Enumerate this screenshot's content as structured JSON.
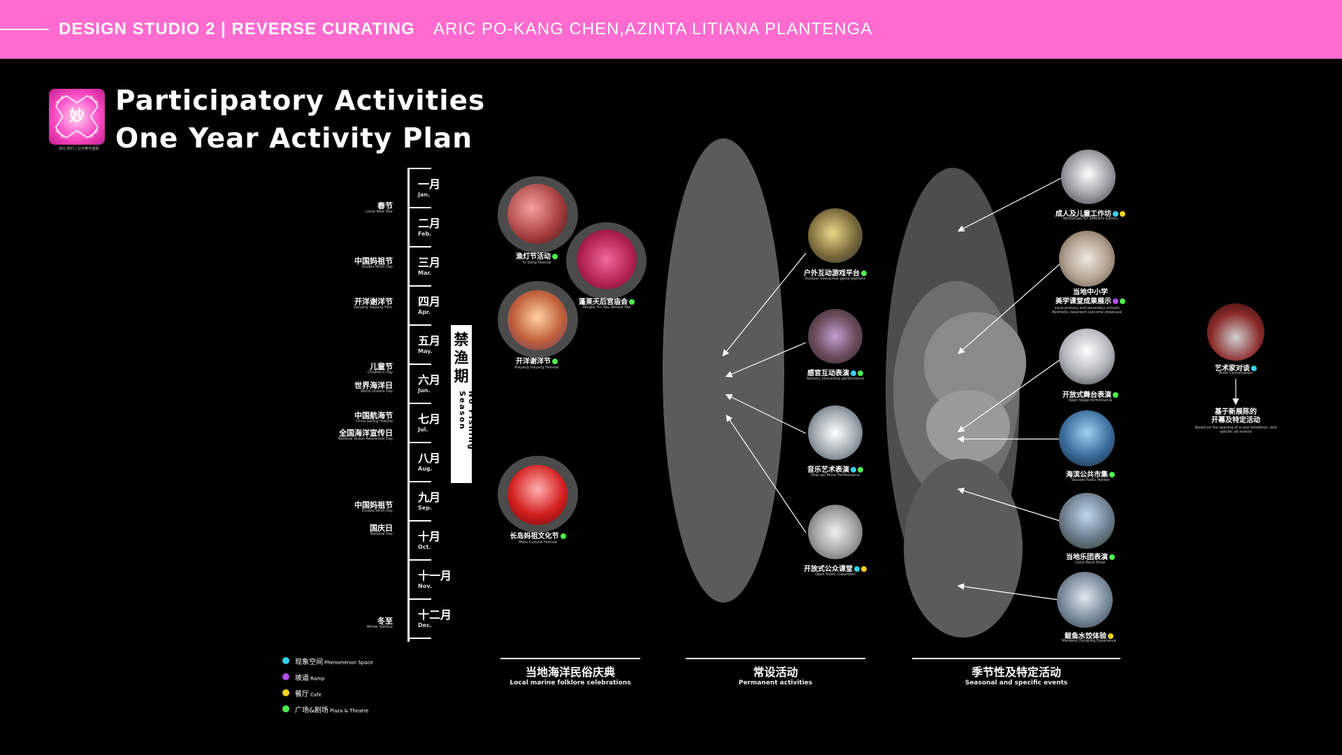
{
  "header": {
    "studio": "DESIGN STUDIO 2 | REVERSE CURATING",
    "authors": "ARIC PO-KANG CHEN,AZINTA LITIANA PLANTENGA"
  },
  "logo": {
    "glyph": "妙",
    "caption": "妙心·妙行 | 公众参与活动"
  },
  "title": {
    "line1": "Participatory Activities",
    "line2": "One Year Activity Plan"
  },
  "months": [
    {
      "zh": "一月",
      "en": "Jan."
    },
    {
      "zh": "二月",
      "en": "Feb."
    },
    {
      "zh": "三月",
      "en": "Mar."
    },
    {
      "zh": "四月",
      "en": "Apr."
    },
    {
      "zh": "五月",
      "en": "May."
    },
    {
      "zh": "六月",
      "en": "Jun."
    },
    {
      "zh": "七月",
      "en": "Jul."
    },
    {
      "zh": "八月",
      "en": "Aug."
    },
    {
      "zh": "九月",
      "en": "Sep."
    },
    {
      "zh": "十月",
      "en": "Oct."
    },
    {
      "zh": "十一月",
      "en": "Nov."
    },
    {
      "zh": "十二月",
      "en": "Dec."
    }
  ],
  "festivals": [
    {
      "zh": "春节",
      "en": "Lunar New Year"
    },
    {
      "zh": "中国妈祖节",
      "en": "Double Ninth Day"
    },
    {
      "zh": "开洋谢洋节",
      "en": "Kaiyang Xieyang Fest."
    },
    {
      "zh": "儿童节",
      "en": "Children's Day"
    },
    {
      "zh": "世界海洋日",
      "en": "World Oceans Day"
    },
    {
      "zh": "中国航海节",
      "en": "China Sailing Festival"
    },
    {
      "zh": "全国海洋宣传日",
      "en": "National Ocean Awareness Day"
    },
    {
      "zh": "中国妈祖节",
      "en": "Double Ninth Day"
    },
    {
      "zh": "国庆日",
      "en": "National Day"
    },
    {
      "zh": "冬至",
      "en": "Winter Solstice"
    }
  ],
  "no_fishing": {
    "zh": "禁渔期",
    "en": "No Fishing Season"
  },
  "folklore": [
    {
      "zh": "渔灯节活动",
      "en": "Yu Deng Festival",
      "dots": [
        "green"
      ]
    },
    {
      "zh": "蓬莱天后宫庙会",
      "en": "Penglai Tin Hau Temple Fair",
      "dots": [
        "green"
      ]
    },
    {
      "zh": "开洋谢洋节",
      "en": "Kaiyang Xieyang Festival",
      "dots": [
        "green"
      ]
    },
    {
      "zh": "长岛妈祖文化节",
      "en": "Mazu Cultural Festival",
      "dots": [
        "green"
      ]
    }
  ],
  "permanent": [
    {
      "zh": "户外互动游戏平台",
      "en": "Outdoor interactive game platform",
      "dots": [
        "green"
      ]
    },
    {
      "zh": "感官互动表演",
      "en": "Sensory interactive performance",
      "dots": [
        "cyan",
        "green"
      ]
    },
    {
      "zh": "音乐艺术表演",
      "en": "(Pop-up) Music Performance",
      "dots": [
        "cyan",
        "green"
      ]
    },
    {
      "zh": "开放式公众课堂",
      "en": "Open Public Classroom",
      "dots": [
        "cyan",
        "yellow"
      ]
    }
  ],
  "seasonal": [
    {
      "zh": "成人及儿童工作坊",
      "en": "Workshops for different visitors",
      "dots": [
        "cyan",
        "yellow"
      ]
    },
    {
      "zh": "当地中小学\n美学课堂成果展示",
      "en": "Local primary and secondary schools Aesthetic classroom outcome showcase",
      "dots": [
        "purple",
        "green"
      ]
    },
    {
      "zh": "开放式舞台表演",
      "en": "Open Stage Performance",
      "dots": [
        "green"
      ]
    },
    {
      "zh": "海滨公共市集",
      "en": "Seaside Public Market",
      "dots": [
        "green"
      ]
    },
    {
      "zh": "当地乐团表演",
      "en": "Local Band Show",
      "dots": [
        "green"
      ]
    },
    {
      "zh": "鲅鱼水饺体验",
      "en": "Mackerel Dumpling Experience",
      "dots": [
        "yellow"
      ]
    }
  ],
  "artist": {
    "zh": "艺术家对谈",
    "en": "Artist Conversation",
    "dots": [
      "cyan"
    ],
    "note_zh": "基于新展陈的\n开幕及特定活动",
    "note_en": "Based on the opening of a new exhibition, and specific art events"
  },
  "columns": [
    {
      "zh": "当地海洋民俗庆典",
      "en": "Local marine folklore celebrations"
    },
    {
      "zh": "常设活动",
      "en": "Permanent activities"
    },
    {
      "zh": "季节性及特定活动",
      "en": "Seasonal and specific events"
    }
  ],
  "legend": [
    {
      "color": "cyan",
      "zh": "现象空间",
      "en": "Phenomenon Space"
    },
    {
      "color": "purple",
      "zh": "坡道",
      "en": "Ramp"
    },
    {
      "color": "yellow",
      "zh": "餐厅",
      "en": "Cafe"
    },
    {
      "color": "green",
      "zh": "广场&剧场",
      "en": "Plaza & Theatre"
    }
  ],
  "colors": {
    "accent": "#ff6bcf",
    "cyan": "#34d3f0",
    "purple": "#b24cf0",
    "yellow": "#f5d21c",
    "green": "#4ff050"
  }
}
